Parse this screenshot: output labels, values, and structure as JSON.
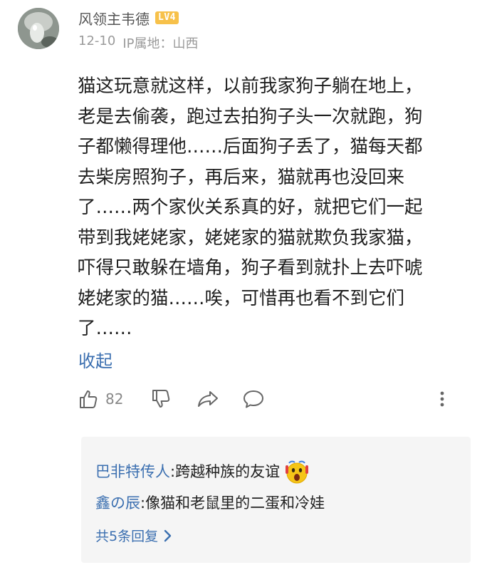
{
  "author": {
    "name": "风领主韦德",
    "level_badge": "LV4",
    "date": "12-10",
    "ip_location": "IP属地：山西"
  },
  "comment": {
    "lines": [
      "猫这玩意就这样，以前我家狗子躺在地上，",
      "老是去偷袭，跑过去拍狗子头一次就跑，狗",
      "子都懒得理他……后面狗子丢了，猫每天都",
      "去柴房照狗子，再后来，猫就再也没回来",
      "了……两个家伙关系真的好，就把它们一起",
      "带到我姥姥家，姥姥家的猫就欺负我家猫，",
      "吓得只敢躲在墙角，狗子看到就扑上去吓唬",
      "姥姥家的猫……唉，可惜再也看不到它们",
      "了……"
    ],
    "collapse_label": "收起"
  },
  "actions": {
    "like_count": "82"
  },
  "replies": {
    "items": [
      {
        "user": "巴非特传人",
        "separator": ": ",
        "text": "跨越种族的友谊"
      },
      {
        "user": "鑫の辰",
        "separator": ": ",
        "text": "像猫和老鼠里的二蛋和冷娃"
      }
    ],
    "more_label": "共5条回复"
  },
  "colors": {
    "link_blue": "#3b6fb0",
    "badge_yellow": "#f7c14a",
    "meta_gray": "#9a9a9a",
    "reply_bg": "#f5f5f5"
  },
  "icons": {
    "like": "thumbs-up-icon",
    "dislike": "thumbs-down-icon",
    "share": "share-icon",
    "comment": "comment-icon",
    "more": "more-vertical-icon",
    "emoji": "shocked-face-emoji",
    "chevron": "chevron-right-icon"
  }
}
